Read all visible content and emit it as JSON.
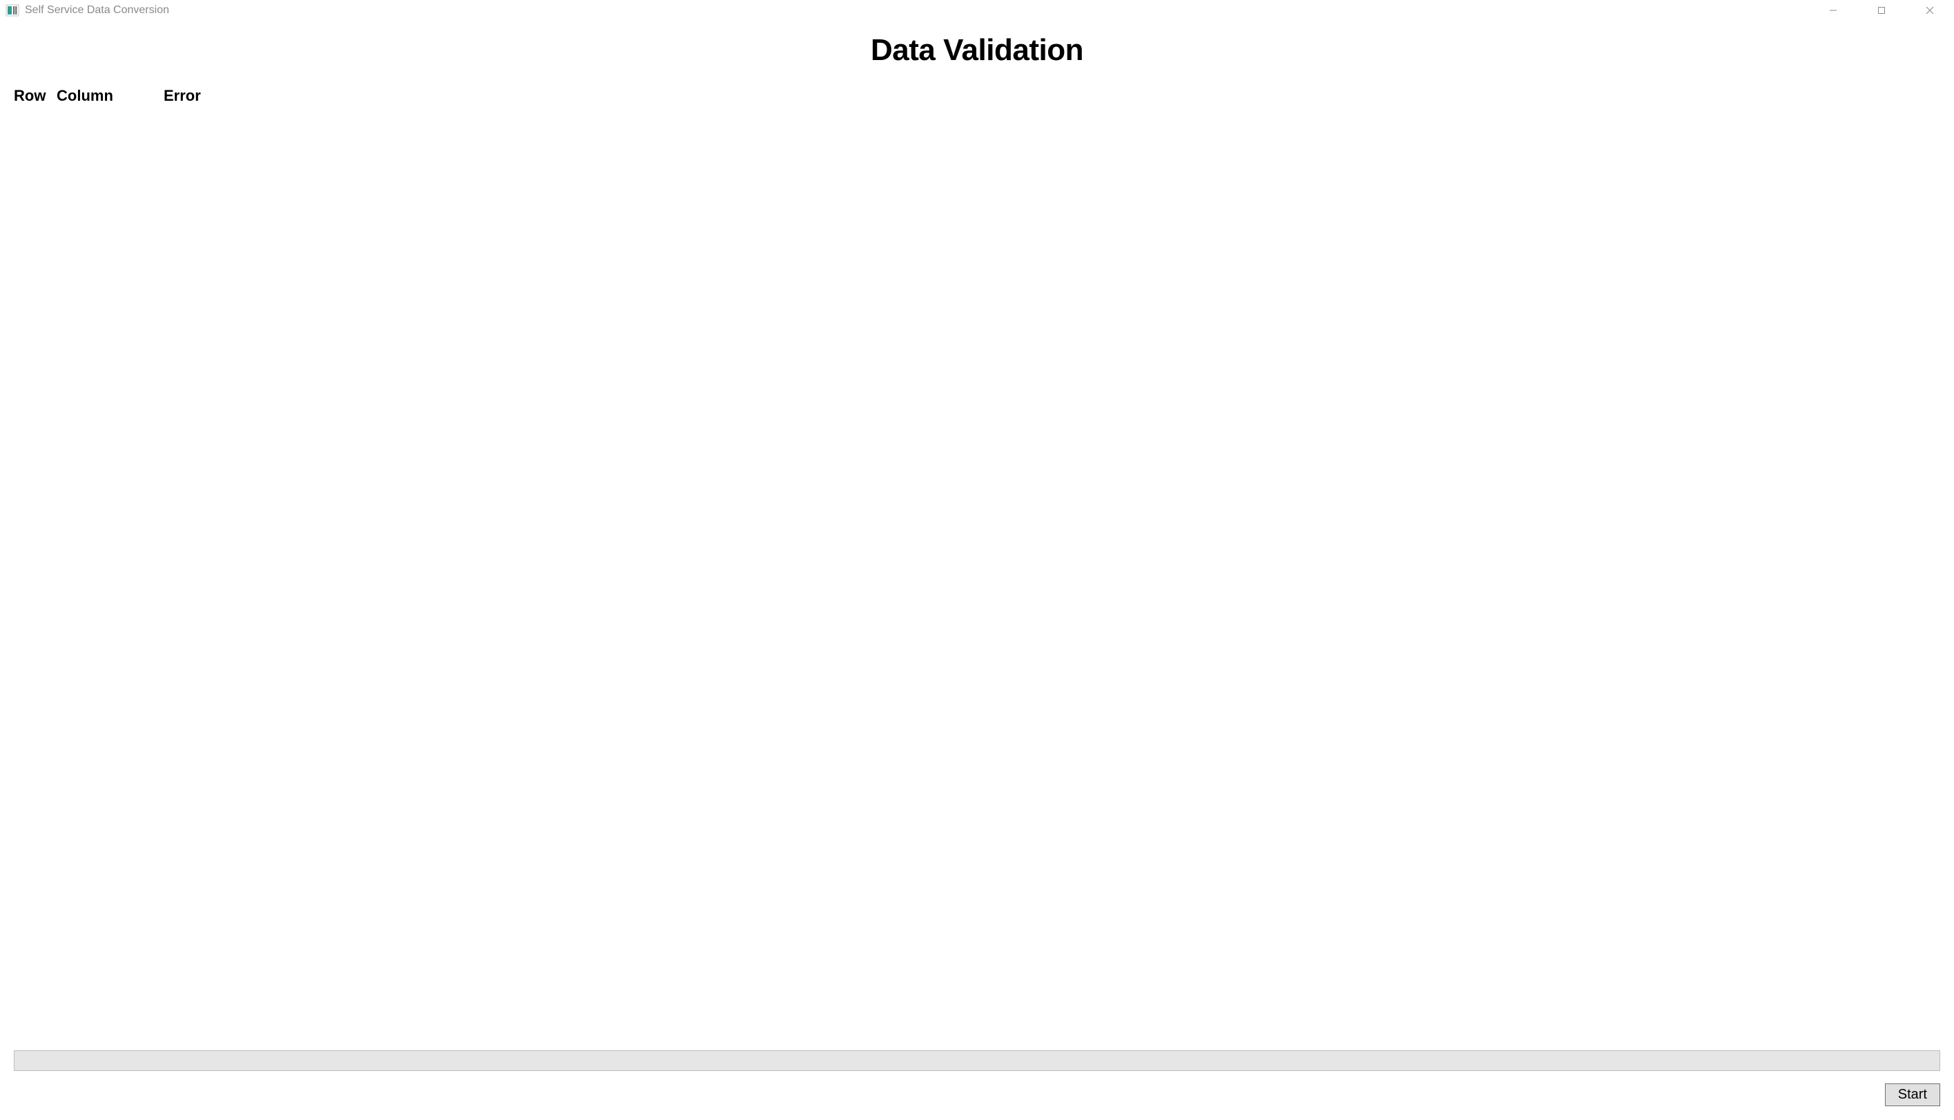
{
  "window": {
    "title": "Self Service Data Conversion"
  },
  "page": {
    "heading": "Data Validation"
  },
  "columns": {
    "row": "Row",
    "column": "Column",
    "error": "Error"
  },
  "rows": [],
  "progress": {
    "value": 0
  },
  "actions": {
    "start": "Start"
  }
}
